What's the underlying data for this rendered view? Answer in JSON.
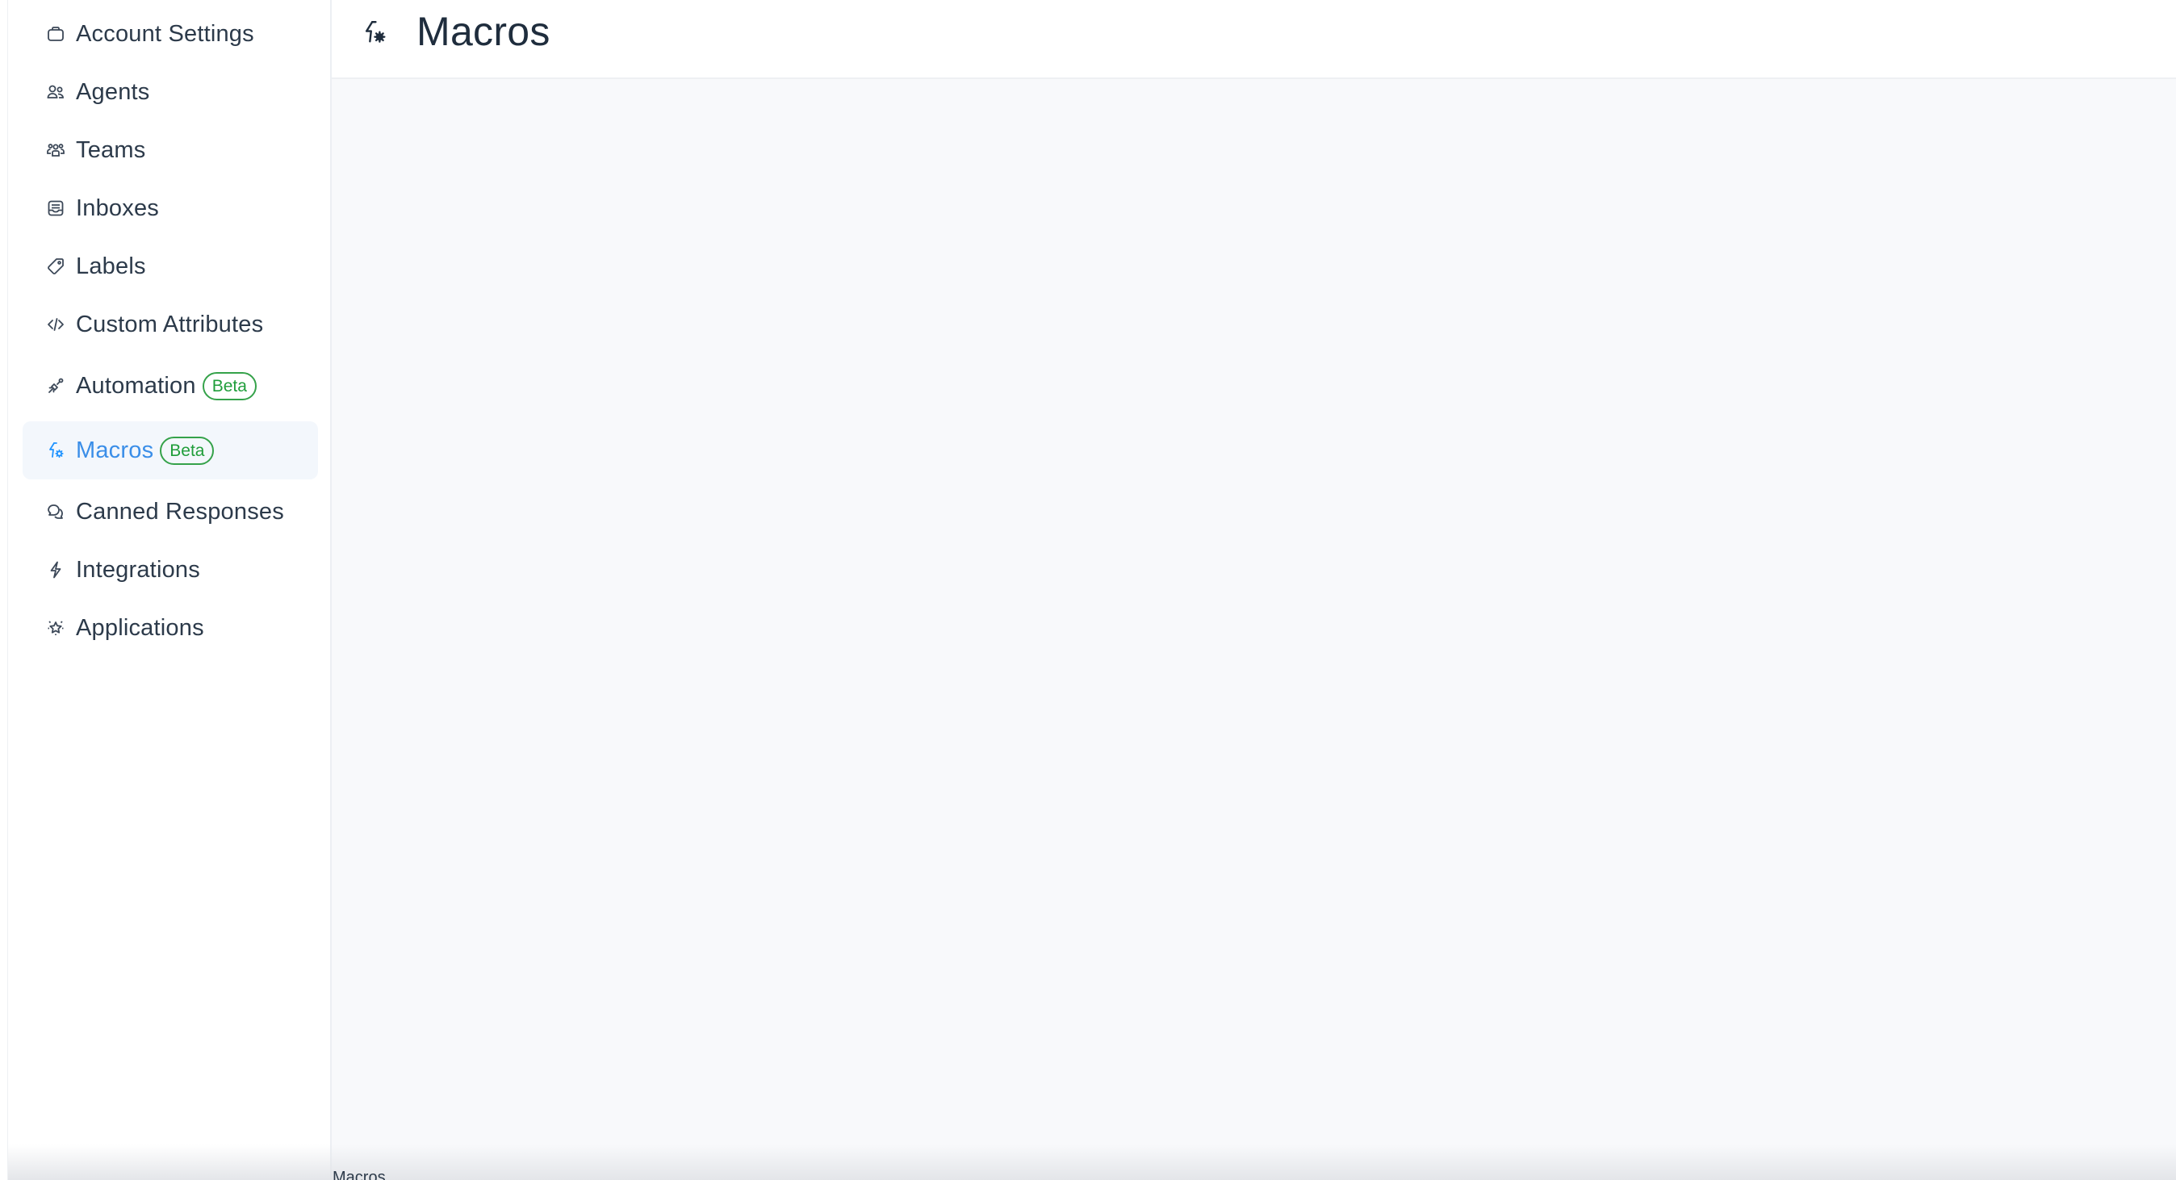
{
  "sidebar": {
    "items": [
      {
        "label": "Account Settings",
        "icon": "briefcase-icon"
      },
      {
        "label": "Agents",
        "icon": "people-icon"
      },
      {
        "label": "Teams",
        "icon": "people-team-icon"
      },
      {
        "label": "Inboxes",
        "icon": "inbox-icon"
      },
      {
        "label": "Labels",
        "icon": "tag-icon"
      },
      {
        "label": "Custom Attributes",
        "icon": "code-icon"
      },
      {
        "label": "Automation",
        "icon": "automation-icon",
        "badge": "Beta"
      },
      {
        "label": "Macros",
        "icon": "macros-icon",
        "badge": "Beta",
        "active": true
      },
      {
        "label": "Canned Responses",
        "icon": "chat-multiple-icon"
      },
      {
        "label": "Integrations",
        "icon": "flash-icon"
      },
      {
        "label": "Applications",
        "icon": "star-emphasis-icon"
      }
    ]
  },
  "header": {
    "title": "Macros",
    "icon": "macros-icon"
  },
  "footer": {
    "title": "Macros"
  },
  "colors": {
    "accent": "#1f93ff",
    "active_text": "#3a8ee8",
    "active_bg": "#f3f7fc",
    "badge_green": "#35a24a",
    "main_bg": "#f8f9fb"
  }
}
